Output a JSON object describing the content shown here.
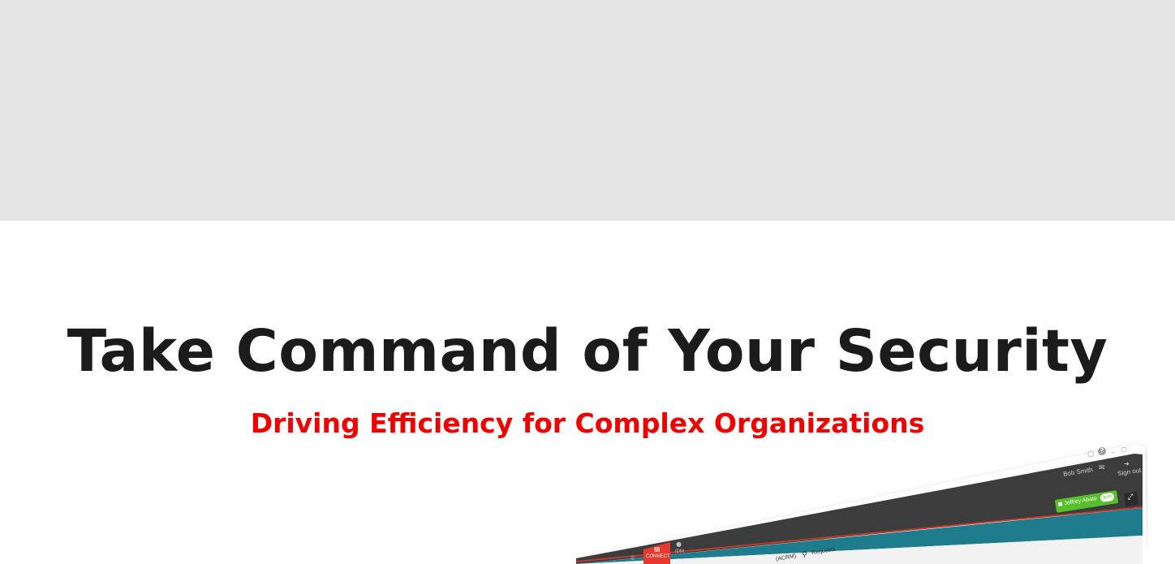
{
  "hero": {
    "title": "Take Command of Your Security",
    "subtitle": "Driving Efficiency for Complex Organizations"
  },
  "colors": {
    "band": "#e4e4e4",
    "title": "#1b1b1b",
    "subtitle": "#f10000",
    "nav_dark": "#3c3c3c",
    "teal_bar": "#1f7c8c",
    "accent_red": "#e8372c",
    "user_green": "#56c02b"
  },
  "app": {
    "header": {
      "user_name": "Bob Smith",
      "mail_icon": "mail-icon",
      "signout_label": "Sign out",
      "signout_icon": "signout-icon",
      "window_icons": [
        "lock-icon",
        "help-icon",
        "minimize-icon",
        "restore-icon"
      ]
    },
    "subbar": {
      "active_user": "Jeffrey Abate",
      "active_user_badge": "acm",
      "lock_icon": "lock-icon",
      "expand_icon": "expand-icon"
    },
    "nav": {
      "items": [
        {
          "icon": "trophy-icon",
          "label": ""
        },
        {
          "icon": "calendar-icon",
          "label": "CONNECT",
          "active": true
        },
        {
          "icon": "user-icon",
          "label": "IDM"
        }
      ]
    },
    "tabs": {
      "partial_label": "(ACRM)",
      "requests_label": "Requests",
      "requests_icon": "key-icon"
    }
  }
}
